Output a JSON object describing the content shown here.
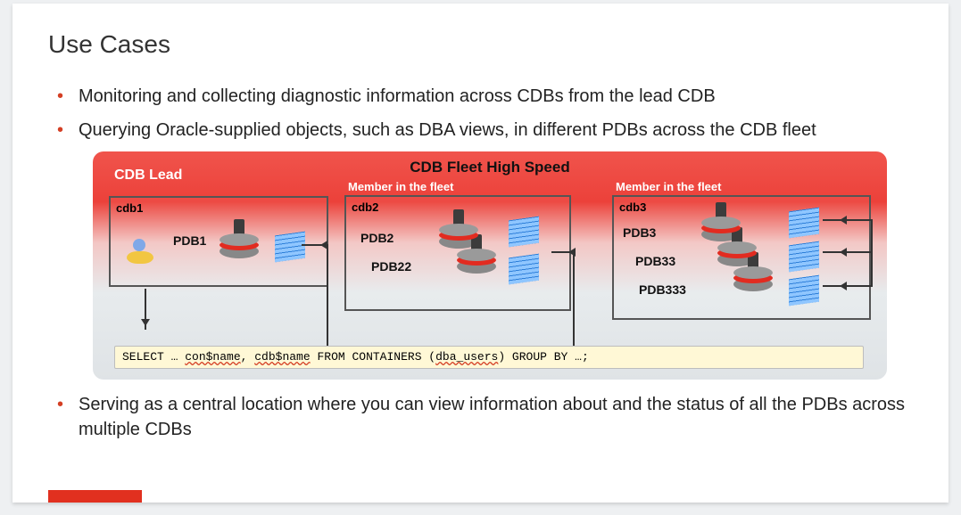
{
  "title": "Use Cases",
  "bullets": {
    "b1": "Monitoring and collecting diagnostic information across CDBs from the lead CDB",
    "b2": "Querying Oracle-supplied objects, such as DBA views, in different PDBs across the CDB fleet",
    "b3": "Serving as a central location where you can view information about and the status of all the PDBs across multiple CDBs"
  },
  "diagram": {
    "fleet_title": "CDB Fleet High Speed",
    "lead_label": "CDB Lead",
    "member_label": "Member in the fleet",
    "cdb1": {
      "name": "cdb1",
      "pdbs": [
        "PDB1"
      ]
    },
    "cdb2": {
      "name": "cdb2",
      "pdbs": [
        "PDB2",
        "PDB22"
      ]
    },
    "cdb3": {
      "name": "cdb3",
      "pdbs": [
        "PDB3",
        "PDB33",
        "PDB333"
      ]
    },
    "sql_prefix": "SELECT … ",
    "sql_con": "con$name",
    "sql_sep": ", ",
    "sql_cdb": "cdb$name",
    "sql_from": " FROM CONTAINERS (",
    "sql_dba": "dba_users",
    "sql_suffix": ") GROUP BY …;"
  }
}
